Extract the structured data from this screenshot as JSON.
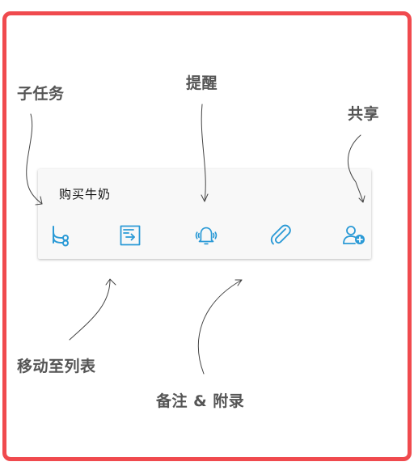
{
  "task": {
    "title": "购买牛奶"
  },
  "toolbar": {
    "accent_color": "#2b9ad6",
    "buttons": [
      {
        "name": "subtask",
        "icon": "subtask-branch-icon"
      },
      {
        "name": "move-to-list",
        "icon": "move-to-list-icon"
      },
      {
        "name": "reminder",
        "icon": "bell-ringing-icon"
      },
      {
        "name": "note-attachment",
        "icon": "paperclip-icon"
      },
      {
        "name": "share",
        "icon": "add-person-icon"
      }
    ]
  },
  "annotations": {
    "subtask": "子任务",
    "reminder": "提醒",
    "share": "共享",
    "move_to_list": "移动至列表",
    "note_attachment": "备注 & 附录"
  },
  "frame": {
    "border_color": "#f04a4e"
  }
}
